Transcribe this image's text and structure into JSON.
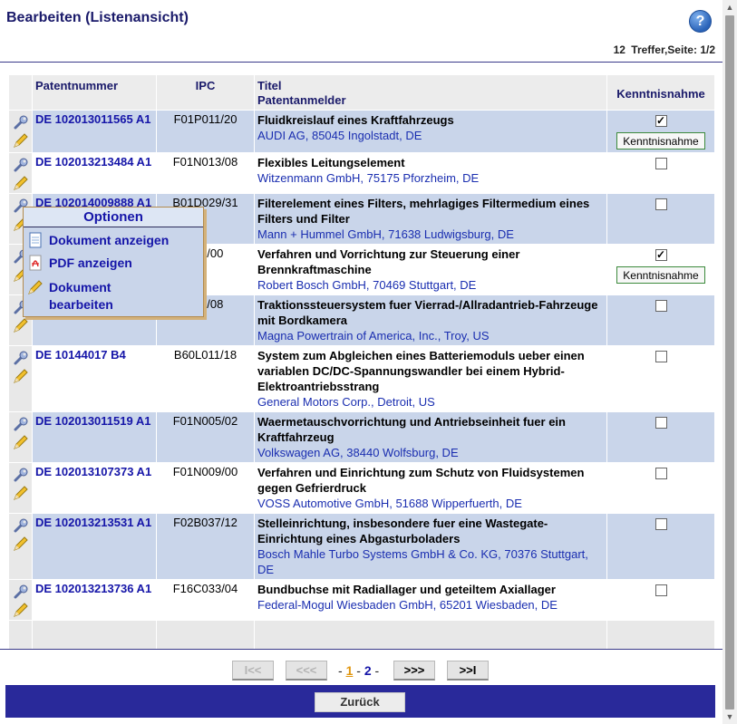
{
  "header": {
    "title": "Bearbeiten (Listenansicht)",
    "help_icon": "?",
    "hits_count": "12",
    "hits_text": "Treffer,Seite: 1/2"
  },
  "table": {
    "columns": {
      "patent": "Patentnummer",
      "ipc": "IPC",
      "title": "Titel",
      "applicant": "Patentanmelder",
      "ack": "Kenntnisnahme"
    },
    "rows": [
      {
        "pn": "DE 102013011565 A1",
        "ipc": "F01P011/20",
        "title": "Fluidkreislauf eines Kraftfahrzeugs",
        "applicant": "AUDI AG, 85045 Ingolstadt, DE",
        "checked": true,
        "button": "Kenntnisnahme"
      },
      {
        "pn": "DE 102013213484 A1",
        "ipc": "F01N013/08",
        "title": "Flexibles Leitungselement",
        "applicant": "Witzenmann GmbH, 75175 Pforzheim, DE",
        "checked": false
      },
      {
        "pn": "DE 102014009888 A1",
        "ipc": "B01D029/31",
        "title": "Filterelement eines Filters, mehrlagiges Filtermedium eines Filters und Filter",
        "applicant": "Mann + Hummel GmbH, 71638 Ludwigsburg, DE",
        "checked": false
      },
      {
        "pn": "",
        "ipc": "045/00",
        "title": "Verfahren und Vorrichtung zur Steuerung einer Brennkraftmaschine",
        "applicant": "Robert Bosch GmbH, 70469 Stuttgart, DE",
        "checked": true,
        "button": "Kenntnisnahme"
      },
      {
        "pn": "",
        "ipc": "023/08",
        "title": "Traktionssteuersystem fuer Vierrad-/Allradantrieb-Fahrzeuge mit Bordkamera",
        "applicant": "Magna Powertrain of America, Inc., Troy, US",
        "checked": false
      },
      {
        "pn": "DE 10144017 B4",
        "ipc": "B60L011/18",
        "title": "System zum Abgleichen eines Batteriemoduls ueber einen variablen DC/DC-Spannungswandler bei einem Hybrid-Elektroantriebsstrang",
        "applicant": "General Motors Corp., Detroit, US",
        "checked": false
      },
      {
        "pn": "DE 102013011519 A1",
        "ipc": "F01N005/02",
        "title": "Waermetauschvorrichtung und Antriebseinheit fuer ein Kraftfahrzeug",
        "applicant": "Volkswagen AG, 38440 Wolfsburg, DE",
        "checked": false
      },
      {
        "pn": "DE 102013107373 A1",
        "ipc": "F01N009/00",
        "title": "Verfahren und Einrichtung zum Schutz von Fluidsystemen gegen Gefrierdruck",
        "applicant": "VOSS Automotive GmbH, 51688 Wipperfuerth, DE",
        "checked": false
      },
      {
        "pn": "DE 102013213531 A1",
        "ipc": "F02B037/12",
        "title": "Stelleinrichtung, insbesondere fuer eine Wastegate-Einrichtung eines Abgasturboladers",
        "applicant": "Bosch Mahle Turbo Systems GmbH & Co. KG, 70376 Stuttgart, DE",
        "checked": false
      },
      {
        "pn": "DE 102013213736 A1",
        "ipc": "F16C033/04",
        "title": "Bundbuchse mit Radiallager und geteiltem Axiallager",
        "applicant": "Federal-Mogul Wiesbaden GmbH, 65201 Wiesbaden, DE",
        "checked": false
      }
    ]
  },
  "popup": {
    "title": "Optionen",
    "items": [
      "Dokument anzeigen",
      "PDF anzeigen",
      "Dokument bearbeiten"
    ]
  },
  "pager": {
    "first": "I<<",
    "prev": "<<<",
    "page1": "1",
    "page2": "2",
    "next": ">>>",
    "last": ">>I"
  },
  "footer": {
    "back": "Zurück"
  },
  "colors": {
    "band": "#c9d5ea",
    "link": "#1515a8",
    "header_text": "#1a1a6a",
    "footer": "#29299a"
  }
}
